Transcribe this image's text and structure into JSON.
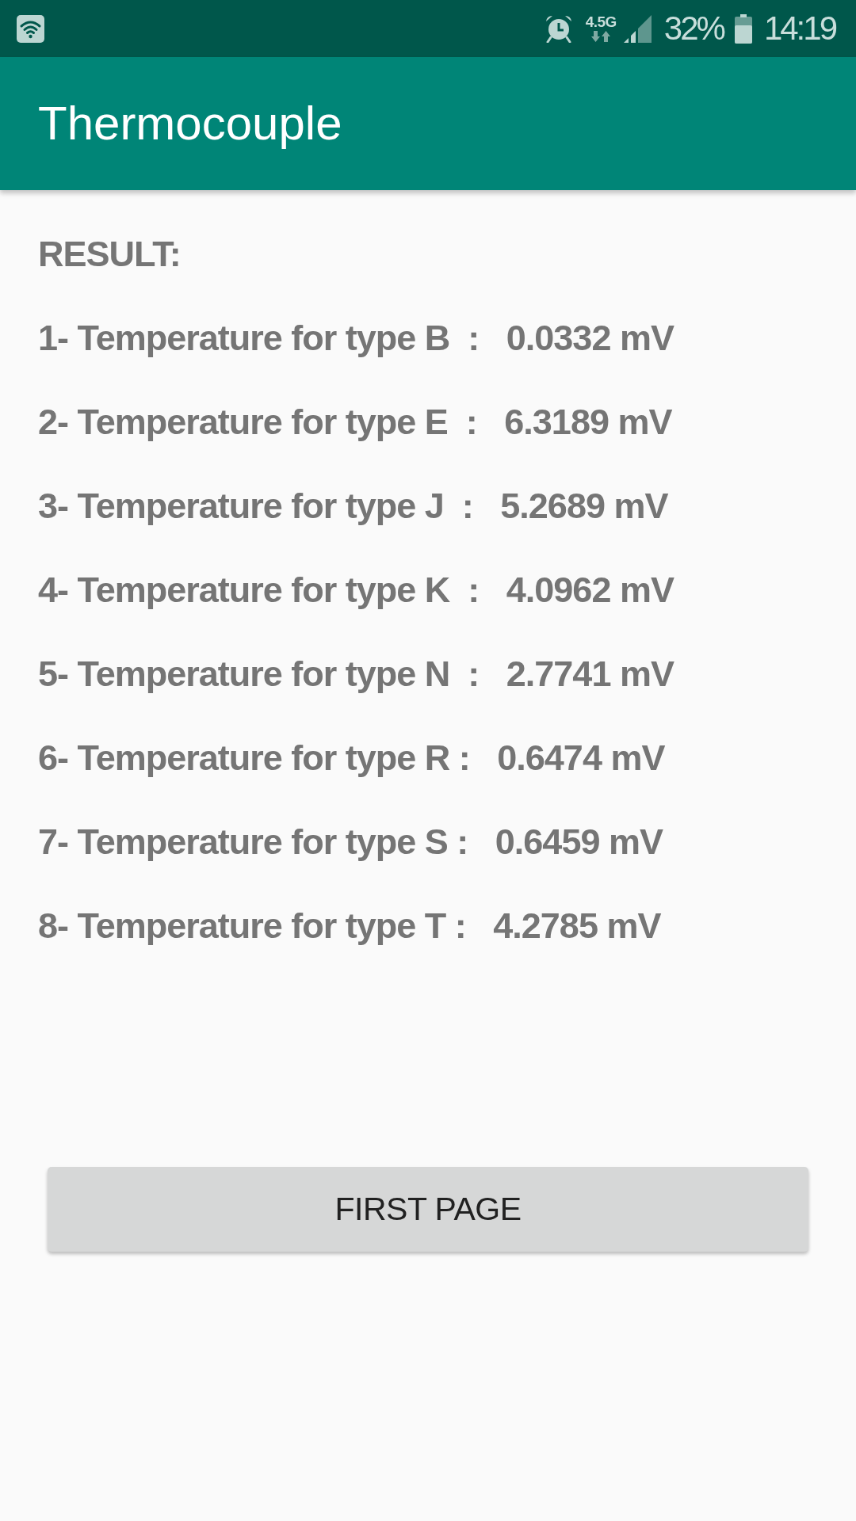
{
  "status_bar": {
    "network": "4.5G",
    "battery": "32%",
    "time": "14:19"
  },
  "app_bar": {
    "title": "Thermocouple"
  },
  "content": {
    "heading": "RESULT:",
    "lines": [
      "1- Temperature for type B  :   0.0332 mV",
      "2- Temperature for type E  :   6.3189 mV",
      "3- Temperature for type J  :   5.2689 mV",
      "4- Temperature for type K  :   4.0962 mV",
      "5- Temperature for type N  :   2.7741 mV",
      "6- Temperature for type R :   0.6474 mV",
      "7- Temperature for type S :   0.6459 mV",
      "8- Temperature for type T :   4.2785 mV"
    ]
  },
  "button": {
    "label": "FIRST PAGE"
  }
}
